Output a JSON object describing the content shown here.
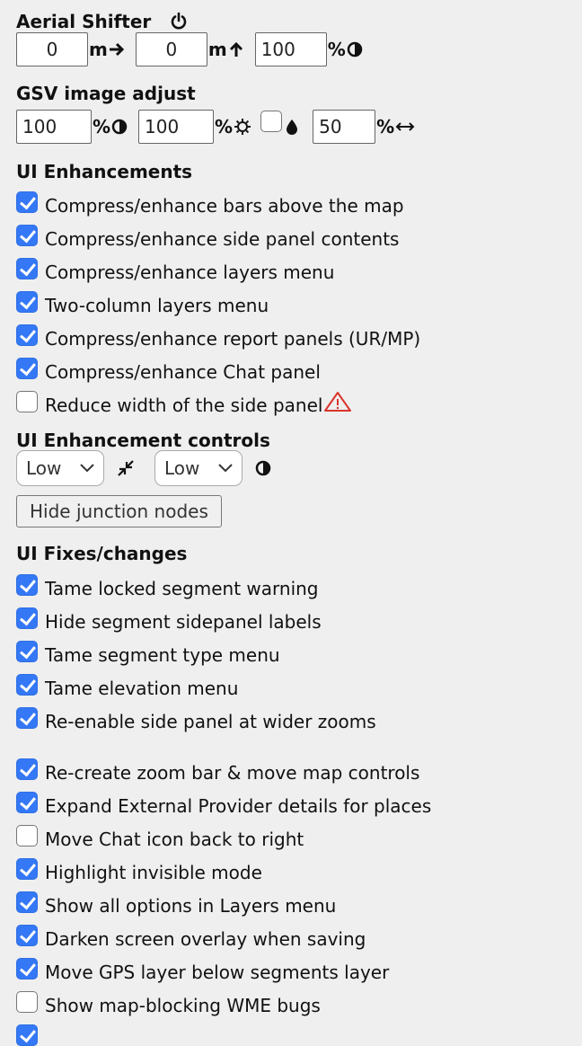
{
  "aerial": {
    "title": "Aerial Shifter",
    "x_value": "0",
    "x_unit": "m",
    "y_value": "0",
    "y_unit": "m",
    "opacity_value": "100",
    "opacity_unit": "%"
  },
  "gsv": {
    "title": "GSV image adjust",
    "contrast_value": "100",
    "contrast_unit": "%",
    "brightness_value": "100",
    "brightness_unit": "%",
    "width_value": "50",
    "width_unit": "%"
  },
  "ui_enhancements": {
    "title": "UI Enhancements",
    "items": [
      {
        "label": "Compress/enhance bars above the map",
        "checked": true
      },
      {
        "label": "Compress/enhance side panel contents",
        "checked": true
      },
      {
        "label": "Compress/enhance layers menu",
        "checked": true
      },
      {
        "label": "Two-column layers menu",
        "checked": true
      },
      {
        "label": "Compress/enhance report panels (UR/MP)",
        "checked": true
      },
      {
        "label": "Compress/enhance Chat panel",
        "checked": true
      },
      {
        "label": "Reduce width of the side panel",
        "checked": false
      }
    ]
  },
  "controls": {
    "title": "UI Enhancement controls",
    "compression_select": "Low",
    "contrast_select": "Low",
    "hide_nodes_button": "Hide junction nodes"
  },
  "ui_fixes": {
    "title": "UI Fixes/changes",
    "items": [
      {
        "label": "Tame locked segment warning",
        "checked": true
      },
      {
        "label": "Hide segment sidepanel labels",
        "checked": true
      },
      {
        "label": "Tame segment type menu",
        "checked": true
      },
      {
        "label": "Tame elevation menu",
        "checked": true
      },
      {
        "label": "Re-enable side panel at wider zooms",
        "checked": true
      },
      {
        "label": "Re-create zoom bar & move map controls",
        "checked": true
      },
      {
        "label": "Expand External Provider details for places",
        "checked": true
      },
      {
        "label": "Move Chat icon back to right",
        "checked": false
      },
      {
        "label": "Highlight invisible mode",
        "checked": true
      },
      {
        "label": "Show all options in Layers menu",
        "checked": true
      },
      {
        "label": "Darken screen overlay when saving",
        "checked": true
      },
      {
        "label": "Move GPS layer below segments layer",
        "checked": true
      },
      {
        "label": "Show map-blocking WME bugs",
        "checked": false
      }
    ]
  },
  "colors": {
    "checkbox_on": "#3478f6",
    "warning": "#d9342b",
    "background": "#efefef"
  }
}
